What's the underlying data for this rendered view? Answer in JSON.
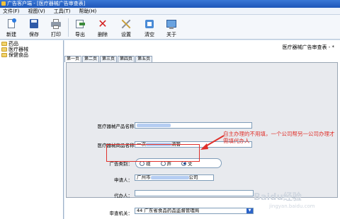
{
  "window": {
    "title": "广告客户端 - [医疗器械广告审查表]"
  },
  "menu": [
    "文件(F)",
    "视图(V)",
    "工具(T)",
    "帮助(H)"
  ],
  "toolbar": {
    "new": "新建",
    "save": "保存",
    "print": "打印",
    "export": "导出",
    "delete": "删除",
    "settings": "设置",
    "clear": "清空",
    "about": "关于"
  },
  "tree": [
    "药品",
    "医疗器械",
    "保健食品"
  ],
  "report_title": "医疗器械广告审查表 - *",
  "tabs": [
    "第一页",
    "第二页",
    "第三页",
    "第四页",
    "第五页"
  ],
  "form": {
    "product_name_label": "医疗器械产品名称：",
    "product_name_value": "",
    "trade_name_label": "医疗器械商品名称：",
    "trade_name_value_prefix": "一次",
    "trade_name_value_suffix": "流管",
    "ad_type_label": "广告类别：",
    "ad_types": [
      "视",
      "声",
      "文"
    ],
    "applicant_label": "申请人：",
    "applicant_prefix": "广州市",
    "applicant_suffix": "公司",
    "agent_label": "代办人：",
    "agent_value": "",
    "authority_label": "审查机关：",
    "authority_value": "44 广东省食品药品监督管理局"
  },
  "annotation": "自主办理的不用填，一个公司帮另一公司办理才需填代办人",
  "watermark": {
    "brand": "Baidu经验",
    "url": "jingyan.baidu.com"
  },
  "colors": {
    "annotation_red": "#e0312b",
    "title_blue": "#1e56b8"
  }
}
